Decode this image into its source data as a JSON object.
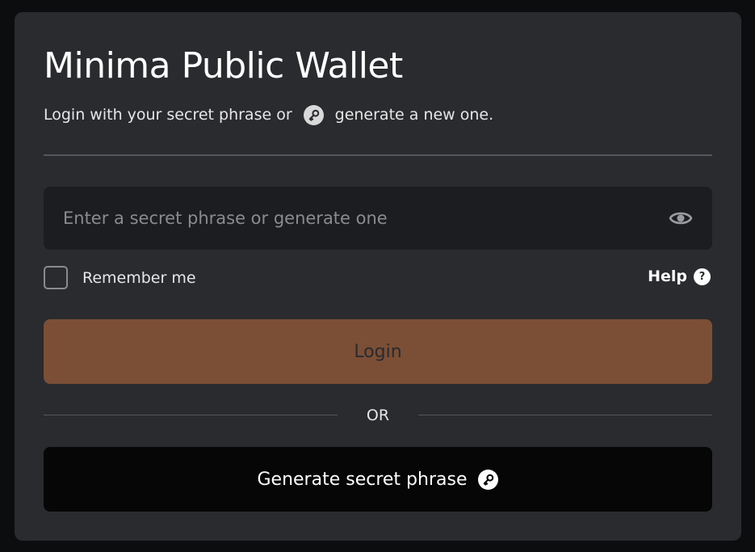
{
  "card": {
    "title": "Minima Public Wallet",
    "subtitle_before": "Login with your secret phrase or",
    "subtitle_icon": "key-icon",
    "subtitle_after": "generate a new one."
  },
  "secret_input": {
    "placeholder": "Enter a secret phrase or generate one",
    "value": "",
    "toggle_icon": "eye-icon"
  },
  "remember": {
    "label": "Remember me",
    "checked": false
  },
  "help": {
    "label": "Help",
    "icon": "question-icon",
    "icon_glyph": "?"
  },
  "login_button": {
    "label": "Login"
  },
  "separator": {
    "label": "OR"
  },
  "generate_button": {
    "label": "Generate secret phrase",
    "icon": "key-icon"
  },
  "colors": {
    "background": "#0c0d0f",
    "card": "#2a2b2f",
    "input": "#1c1d20",
    "login_button": "#7a4f35",
    "generate_button": "#060607"
  }
}
